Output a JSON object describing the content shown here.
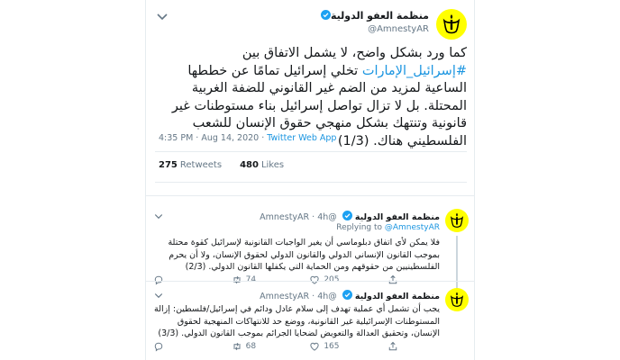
{
  "main_tweet": {
    "display_name": "منظمة العفو الدولية",
    "handle": "@AmnestyAR",
    "text_before_hashtag": "كما ورد بشكل واضح، لا يشمل الاتفاق بين ",
    "hashtag": "#إسرائيل_الإمارات",
    "text_after_hashtag": " تخلي إسرائيل تمامًا عن خططها الساعية لمزيد من الضم غير القانوني للضفة الغربية المحتلة. بل لا تزال تواصل إسرائيل بناء مستوطنات غير قانونية وتنتهك بشكل منهجي حقوق الإنسان للشعب الفلسطيني هناك. (1/3)",
    "timestamp": "4:35 PM · Aug 14, 2020 · ",
    "source": "Twitter Web App",
    "retweets_count": "275",
    "retweets_label": "Retweets",
    "likes_count": "480",
    "likes_label": "Likes"
  },
  "replies": [
    {
      "display_name": "منظمة العفو الدولية",
      "handle_time": "@AmnestyAR · 4h",
      "replying_label": "Replying to ",
      "replying_mention": "@AmnestyAR",
      "text": "فلا يمكن لأي اتفاق دبلوماسي أن يغير الواجبات القانونية لإسرائيل كقوة محتلة بموجب القانون الإنساني الدولي والقانون الدولي لحقوق الإنسان، ولا أن يحرم الفلسطينيين من حقوقهم ومن الحماية التي يكفلها القانون الدولي. (2/3)",
      "replies": "",
      "retweets": "74",
      "likes": "205"
    },
    {
      "display_name": "منظمة العفو الدولية",
      "handle_time": "@AmnestyAR · 4h",
      "text": "يجب أن تشمل أي عملية تهدف إلى سلام عادل ودائم في إسرائيل/فلسطين: إزالة المستوطنات الإسرائيلية غير القانونية، ووضع حد للانتهاكات المنهجية لحقوق الإنسان، وتحقيق العدالة والتعويض لضحايا الجرائم بموجب القانون الدولي. (3/3)",
      "replies": "",
      "retweets": "68",
      "likes": "165"
    }
  ],
  "colors": {
    "brand_yellow": "#ffff00",
    "link_blue": "#1b95e0",
    "muted": "#657786"
  }
}
